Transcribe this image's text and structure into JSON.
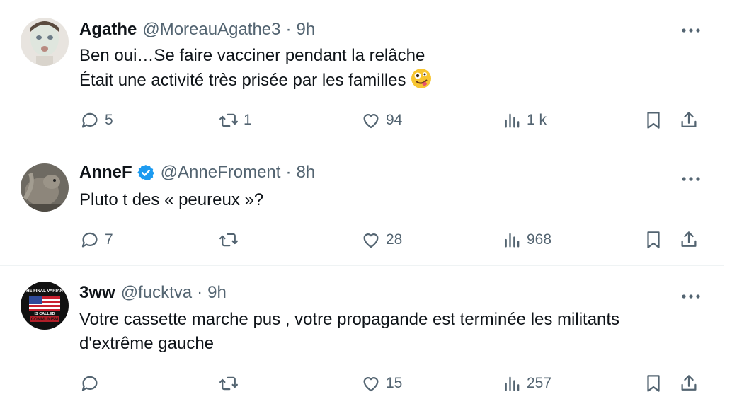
{
  "tweets": [
    {
      "display_name": "Agathe",
      "handle": "@MoreauAgathe3",
      "separator": "·",
      "time": "9h",
      "verified": false,
      "lines": [
        "Ben oui…Se faire vacciner pendant la relâche",
        "Était une activité très prisée par les familles"
      ],
      "emoji": "zany-face",
      "counts": {
        "replies": "5",
        "reposts": "1",
        "likes": "94",
        "views": "1 k"
      }
    },
    {
      "display_name": "AnneF",
      "handle": "@AnneFroment",
      "separator": "·",
      "time": "8h",
      "verified": true,
      "lines": [
        "Pluto t des « peureux »?"
      ],
      "counts": {
        "replies": "7",
        "reposts": "",
        "likes": "28",
        "views": "968"
      }
    },
    {
      "display_name": "3ww",
      "handle": "@fucktva",
      "separator": "·",
      "time": "9h",
      "verified": false,
      "lines": [
        "Votre cassette marche pus , votre propagande est terminée les militants",
        "d'extrême gauche"
      ],
      "avatar_text": {
        "top": "THE FINAL VARIANT",
        "middle": "IS CALLED",
        "bottom": "COMMUNISM"
      },
      "counts": {
        "replies": "",
        "reposts": "",
        "likes": "15",
        "views": "257"
      }
    }
  ],
  "colors": {
    "text": "#0f1419",
    "secondary": "#536471",
    "divider": "#eff3f4",
    "verified": "#1d9bf0"
  },
  "icons": [
    "reply-icon",
    "repost-icon",
    "like-icon",
    "views-icon",
    "bookmark-icon",
    "share-icon",
    "more-icon",
    "verified-badge-icon"
  ]
}
